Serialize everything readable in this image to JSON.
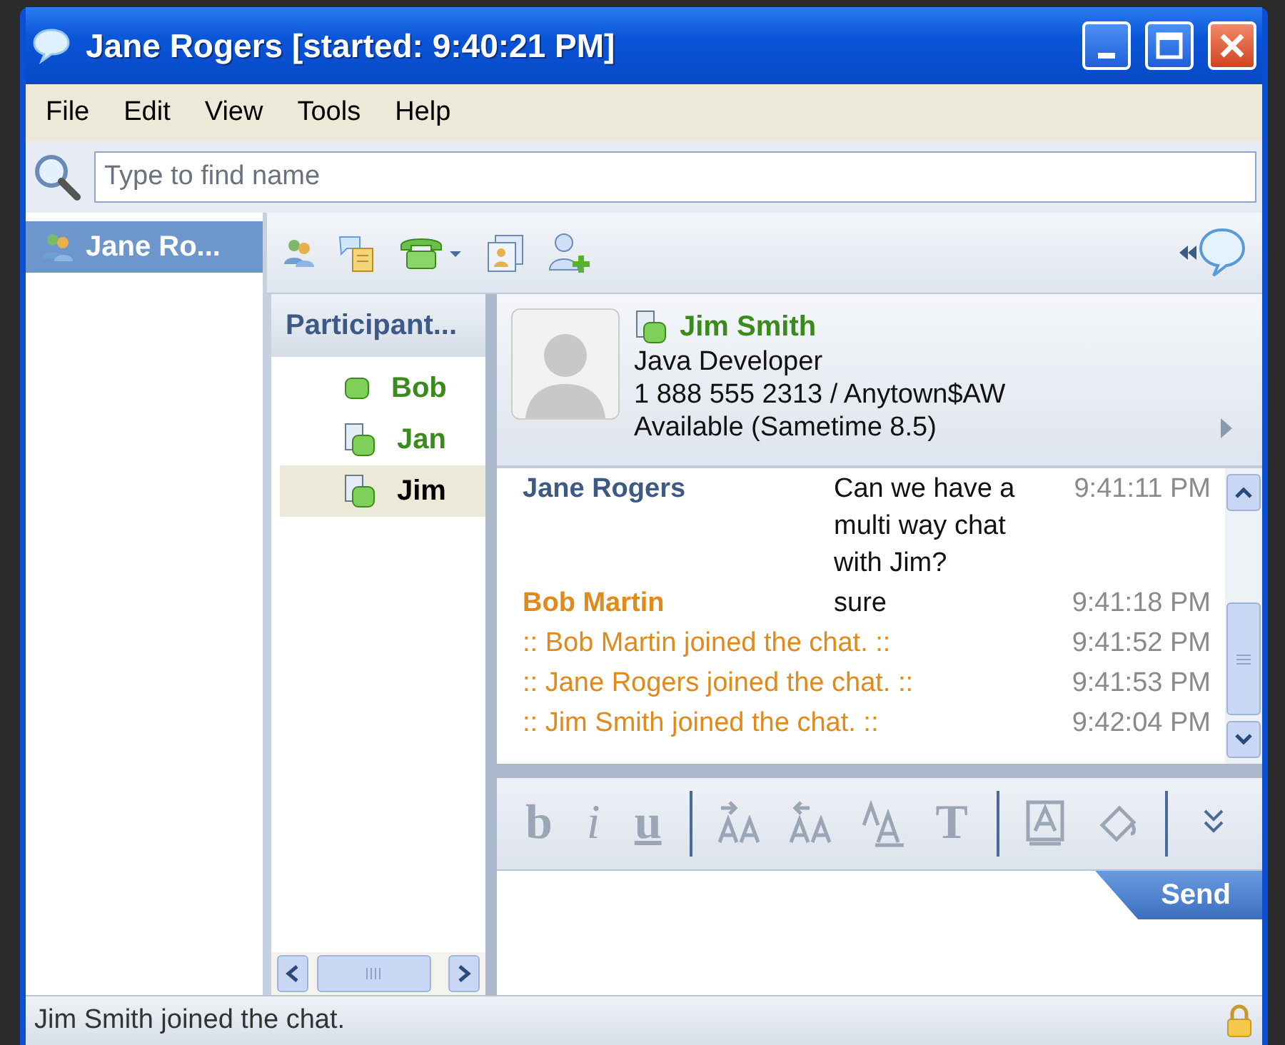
{
  "window": {
    "title": "Jane Rogers [started: 9:40:21 PM]"
  },
  "menu": [
    "File",
    "Edit",
    "View",
    "Tools",
    "Help"
  ],
  "search": {
    "placeholder": "Type to find name"
  },
  "sidebar": {
    "items": [
      {
        "label": "Jane Ro...",
        "selected": true
      }
    ]
  },
  "participants": {
    "title": "Participant...",
    "items": [
      {
        "name": "Bob",
        "kind": "single",
        "selected": false
      },
      {
        "name": "Jan",
        "kind": "multi",
        "selected": false
      },
      {
        "name": "Jim",
        "kind": "multi",
        "selected": true
      }
    ]
  },
  "profile": {
    "name": "Jim Smith",
    "title": "Java Developer",
    "phone": "1 888 555 2313 / Anytown$AW",
    "status": "Available (Sametime 8.5)"
  },
  "messages": [
    {
      "kind": "message",
      "sender": "Jane Rogers",
      "color": "#3d5a84",
      "text": "Can we have a multi way chat with Jim?",
      "time": "9:41:11 PM"
    },
    {
      "kind": "message",
      "sender": "Bob Martin",
      "color": "#e08a1c",
      "text": "sure",
      "time": "9:41:18 PM"
    },
    {
      "kind": "system",
      "text": ":: Bob Martin joined the chat. ::",
      "time": "9:41:52 PM"
    },
    {
      "kind": "system",
      "text": ":: Jane Rogers joined the chat. ::",
      "time": "9:41:53 PM"
    },
    {
      "kind": "system",
      "text": ":: Jim Smith joined the chat. ::",
      "time": "9:42:04 PM"
    }
  ],
  "format_toolbar": [
    {
      "kind": "glyph",
      "label": "b"
    },
    {
      "kind": "glyph",
      "label": "i"
    },
    {
      "kind": "glyph",
      "label": "u"
    },
    {
      "kind": "separator"
    },
    {
      "kind": "icon"
    },
    {
      "kind": "icon"
    },
    {
      "kind": "icon"
    },
    {
      "kind": "glyph",
      "label": "T"
    },
    {
      "kind": "separator"
    },
    {
      "kind": "icon"
    },
    {
      "kind": "icon"
    },
    {
      "kind": "separator"
    },
    {
      "kind": "icon"
    }
  ],
  "send_button": {
    "label": "Send"
  },
  "status_bar": {
    "text": "Jim Smith joined the chat."
  }
}
